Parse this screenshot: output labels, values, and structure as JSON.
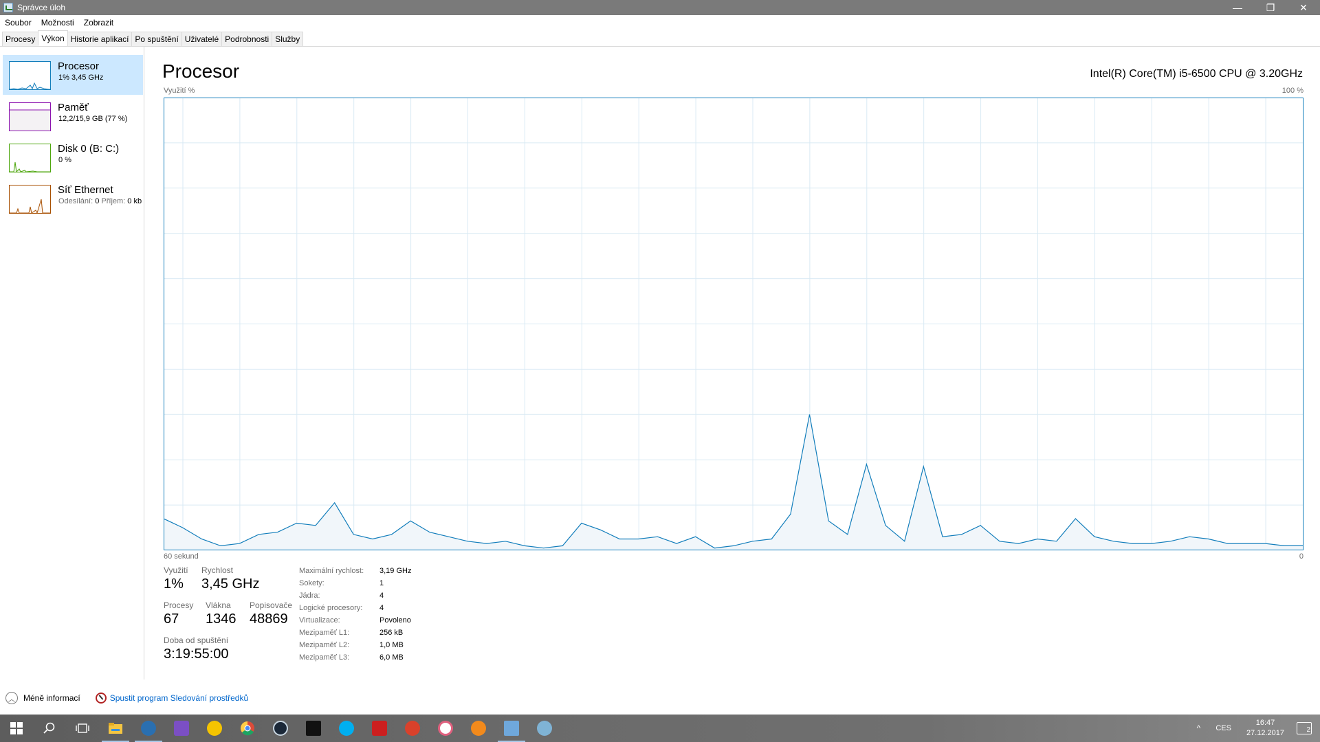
{
  "window": {
    "title": "Správce úloh",
    "controls": {
      "minimize": "—",
      "restore": "❐",
      "close": "✕"
    }
  },
  "menu": [
    "Soubor",
    "Možnosti",
    "Zobrazit"
  ],
  "tabs": [
    "Procesy",
    "Výkon",
    "Historie aplikací",
    "Po spuštění",
    "Uživatelé",
    "Podrobnosti",
    "Služby"
  ],
  "active_tab": "Výkon",
  "sidebar": {
    "items": [
      {
        "name": "Procesor",
        "sub": "1% 3,45 GHz",
        "color": "#117dbb",
        "selected": true
      },
      {
        "name": "Paměť",
        "sub": "12,2/15,9 GB (77 %)",
        "color": "#8b12ae",
        "selected": false
      },
      {
        "name": "Disk 0 (B: C:)",
        "sub": "0 %",
        "color": "#4da60c",
        "selected": false
      },
      {
        "name": "Síť Ethernet",
        "sub_label1": "Odesílání:",
        "sub_val1": "0",
        "sub_label2": "Příjem:",
        "sub_val2": "0 kb",
        "color": "#a74f01",
        "selected": false
      }
    ]
  },
  "main": {
    "title": "Procesor",
    "cpu_model": "Intel(R) Core(TM) i5-6500 CPU @ 3.20GHz",
    "y_label": "Využití %",
    "y_max_label": "100 %",
    "x_left_label": "60 sekund",
    "x_right_label": "0"
  },
  "chart_data": {
    "type": "area",
    "ylabel": "Využití %",
    "xlabel": "60 sekund",
    "ylim": [
      0,
      100
    ],
    "xlim": [
      60,
      0
    ],
    "grid": true,
    "color": "#117dbb",
    "x": [
      60,
      59,
      58,
      57,
      56,
      55,
      54,
      53,
      52,
      51,
      50,
      49,
      48,
      47,
      46,
      45,
      44,
      43,
      42,
      41,
      40,
      39,
      38,
      37,
      36,
      35,
      34,
      33,
      32,
      31,
      30,
      29,
      28,
      27,
      26,
      25,
      24,
      23,
      22,
      21,
      20,
      19,
      18,
      17,
      16,
      15,
      14,
      13,
      12,
      11,
      10,
      9,
      8,
      7,
      6,
      5,
      4,
      3,
      2,
      1,
      0
    ],
    "values": [
      7,
      5,
      2.5,
      1,
      1.5,
      3.5,
      4,
      6,
      5.5,
      10.5,
      3.5,
      2.5,
      3.5,
      6.5,
      4,
      3,
      2,
      1.5,
      2,
      1,
      0.5,
      1,
      6,
      4.5,
      2.5,
      2.5,
      3,
      1.5,
      3,
      0.5,
      1,
      2,
      2.5,
      8,
      30,
      6.5,
      3.5,
      19,
      5.5,
      2,
      18.5,
      3,
      3.5,
      5.5,
      2,
      1.5,
      2.5,
      2,
      7,
      3,
      2,
      1.5,
      1.5,
      2,
      3,
      2.5,
      1.5,
      1.5,
      1.5,
      1,
      1
    ]
  },
  "stats": {
    "usage_label": "Využití",
    "usage_value": "1%",
    "speed_label": "Rychlost",
    "speed_value": "3,45 GHz",
    "processes_label": "Procesy",
    "processes_value": "67",
    "threads_label": "Vlákna",
    "threads_value": "1346",
    "handles_label": "Popisovače",
    "handles_value": "48869",
    "uptime_label": "Doba od spuštění",
    "uptime_value": "3:19:55:00"
  },
  "properties": [
    {
      "k": "Maximální rychlost:",
      "v": "3,19 GHz"
    },
    {
      "k": "Sokety:",
      "v": "1"
    },
    {
      "k": "Jádra:",
      "v": "4"
    },
    {
      "k": "Logické procesory:",
      "v": "4"
    },
    {
      "k": "Virtualizace:",
      "v": "Povoleno"
    },
    {
      "k": "Mezipaměť L1:",
      "v": "256 kB"
    },
    {
      "k": "Mezipaměť L2:",
      "v": "1,0 MB"
    },
    {
      "k": "Mezipaměť L3:",
      "v": "6,0 MB"
    }
  ],
  "footer": {
    "less_info": "Méně informací",
    "resource_monitor": "Spustit program Sledování prostředků"
  },
  "taskbar": {
    "apps": [
      {
        "name": "start-icon",
        "color": "#ffffff"
      },
      {
        "name": "search-icon",
        "color": "#ffffff"
      },
      {
        "name": "task-view-icon",
        "color": "#ffffff"
      },
      {
        "name": "file-explorer-icon",
        "color": "#f4c542"
      },
      {
        "name": "app-blue-swirl-icon",
        "color": "#2a6fb0"
      },
      {
        "name": "visual-studio-icon",
        "color": "#7b4fc4"
      },
      {
        "name": "cyberghost-icon",
        "color": "#f5c400"
      },
      {
        "name": "chrome-icon",
        "color": "#dd4b39"
      },
      {
        "name": "steam-icon",
        "color": "#1b2838"
      },
      {
        "name": "epic-games-icon",
        "color": "#111111"
      },
      {
        "name": "skype-icon",
        "color": "#00aff0"
      },
      {
        "name": "flash-icon",
        "color": "#cc1f1f"
      },
      {
        "name": "app-red-icon",
        "color": "#d9412b"
      },
      {
        "name": "itunes-icon",
        "color": "#e0607e"
      },
      {
        "name": "fl-studio-icon",
        "color": "#f28a1c"
      },
      {
        "name": "task-manager-icon",
        "color": "#6fa8dc"
      },
      {
        "name": "paint-icon",
        "color": "#7fb3d5"
      }
    ],
    "tray_chevron": "^",
    "language": "CES",
    "time": "16:47",
    "date": "27.12.2017",
    "notifications": "2"
  }
}
